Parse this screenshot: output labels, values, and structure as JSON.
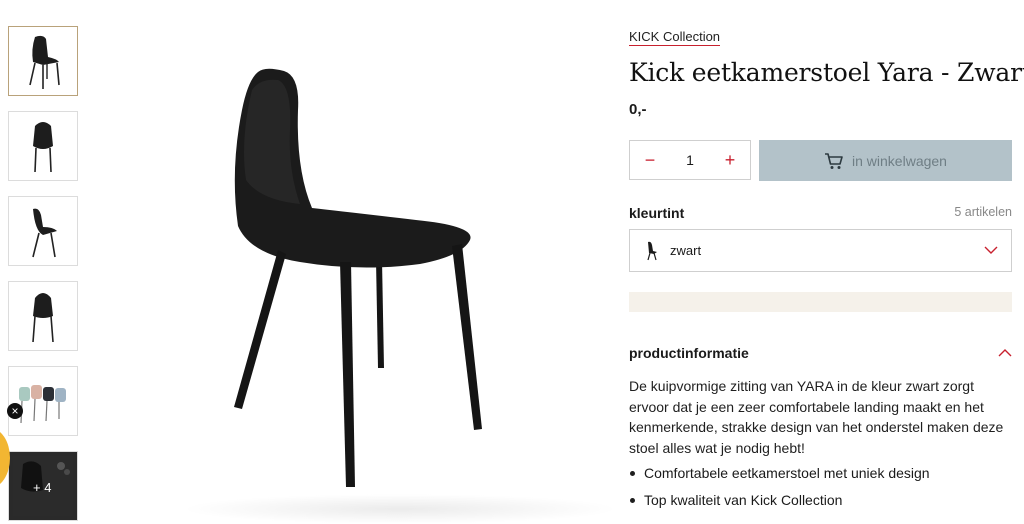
{
  "gallery": {
    "thumbnails": [
      {
        "name": "chair-front-angle"
      },
      {
        "name": "chair-front"
      },
      {
        "name": "chair-side"
      },
      {
        "name": "chair-back"
      },
      {
        "name": "chair-colors-row"
      },
      {
        "name": "chair-lifestyle",
        "more_label": "+ 4"
      }
    ],
    "close_icon": "×"
  },
  "product": {
    "brand": "KICK Collection",
    "title": "Kick eetkamerstoel Yara - Zwart",
    "price": "0,-",
    "quantity": "1",
    "minus": "−",
    "plus": "+",
    "cart_label": "in winkelwagen",
    "color_label": "kleurtint",
    "color_count": "5 artikelen",
    "selected_color": "zwart"
  },
  "info": {
    "heading": "productinformatie",
    "description": "De kuipvormige zitting van YARA in de kleur zwart zorgt ervoor dat je een zeer comfortabele landing maakt en het kenmerkende, strakke design van het onderstel maken deze stoel alles wat je nodig hebt!",
    "bullets": [
      "Comfortabele eetkamerstoel met uniek design",
      "Top kwaliteit van Kick Collection"
    ]
  },
  "colors": {
    "accent_red": "#c8202e",
    "cart_bg": "#b3c2c9",
    "thumb_active_border": "#b9a27a",
    "beige": "#f5f1ea"
  }
}
